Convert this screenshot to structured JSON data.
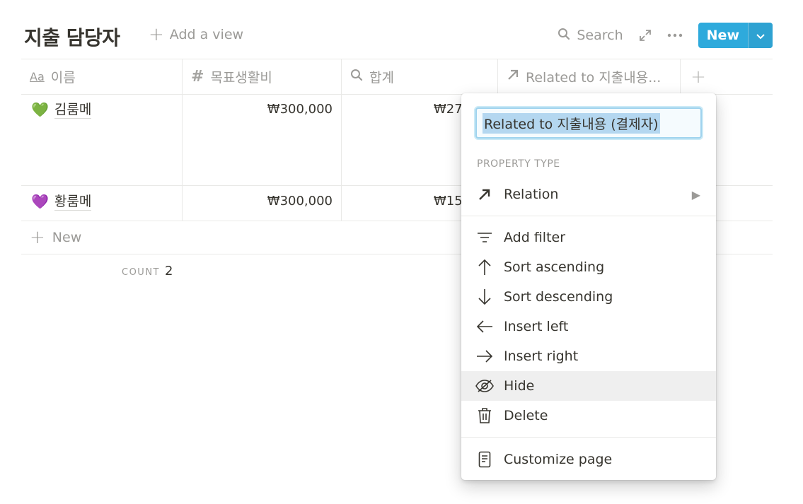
{
  "header": {
    "title": "지출 담당자",
    "add_view": "Add a view",
    "search_label": "Search",
    "new_label": "New"
  },
  "table": {
    "columns": [
      {
        "label": "이름",
        "icon": "text-aa-icon"
      },
      {
        "label": "목표생활비",
        "icon": "hash-icon"
      },
      {
        "label": "합계",
        "icon": "search-formula-icon"
      },
      {
        "label": "Related to 지출내용...",
        "icon": "arrow-up-right-icon"
      }
    ],
    "rows": [
      {
        "emoji": "💚",
        "name": "김룸메",
        "target": "₩300,000",
        "sum": "₩27"
      },
      {
        "emoji": "💜",
        "name": "황룸메",
        "target": "₩300,000",
        "sum": "₩15"
      }
    ],
    "new_row_label": "New",
    "count_label": "COUNT",
    "count_value": "2"
  },
  "menu": {
    "rename_value": "Related to 지출내용 (결제자)",
    "section_label": "PROPERTY TYPE",
    "type_value": "Relation",
    "items": [
      {
        "label": "Add filter",
        "icon": "filter-icon"
      },
      {
        "label": "Sort ascending",
        "icon": "arrow-up-icon"
      },
      {
        "label": "Sort descending",
        "icon": "arrow-down-icon"
      },
      {
        "label": "Insert left",
        "icon": "arrow-left-icon"
      },
      {
        "label": "Insert right",
        "icon": "arrow-right-icon"
      },
      {
        "label": "Hide",
        "icon": "eye-off-icon"
      },
      {
        "label": "Delete",
        "icon": "trash-icon"
      }
    ],
    "customize_label": "Customize page"
  },
  "colors": {
    "accent": "#2eaadc",
    "text": "#37352f",
    "muted": "#9b9a97",
    "hover_bg": "#efefef"
  }
}
